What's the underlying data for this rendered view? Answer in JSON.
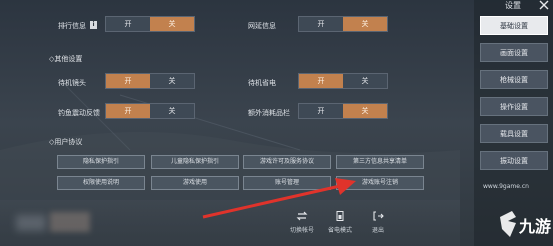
{
  "colors": {
    "toggle_on": "#c2814e",
    "toggle_off": "#3e4955",
    "tab_active": "#e8eaed",
    "tab_inactive": "#4a5461",
    "arrow": "#e0332b"
  },
  "settings_rows": [
    {
      "label": "排行信息",
      "on": "开",
      "off": "关",
      "selected": "off",
      "has_info": true
    },
    {
      "label": "网延信息",
      "on": "开",
      "off": "关",
      "selected": "off",
      "has_info": false
    }
  ],
  "other_settings": {
    "title": "其他设置",
    "rows": [
      {
        "label": "待机镜头",
        "on": "开",
        "off": "关",
        "selected": "on"
      },
      {
        "label": "待机省电",
        "on": "开",
        "off": "关",
        "selected": "on"
      },
      {
        "label": "钓鱼震动反馈",
        "on": "开",
        "off": "关",
        "selected": "on"
      },
      {
        "label": "额外消耗品栏",
        "on": "开",
        "off": "关",
        "selected": "off"
      }
    ]
  },
  "user_agreement": {
    "title": "用户协议",
    "links": [
      "隐私保护指引",
      "儿童隐私保护指引",
      "游戏许可及服务协议",
      "第三方信息共享清单",
      "权限使用说明",
      "游戏使用",
      "账号管理",
      "游戏账号注销"
    ]
  },
  "bottom_buttons": [
    {
      "icon": "switch-account-icon",
      "label": "切换帐号"
    },
    {
      "icon": "power-save-icon",
      "label": "省电模式"
    },
    {
      "icon": "exit-icon",
      "label": "退出"
    }
  ],
  "sidebar": {
    "header": "设置",
    "tabs": [
      "基础设置",
      "画面设置",
      "枪械设置",
      "操作设置",
      "载具设置",
      "振动设置"
    ],
    "active_index": 0
  },
  "watermark": {
    "brand": "九游",
    "domain": "www.9game.cn"
  }
}
